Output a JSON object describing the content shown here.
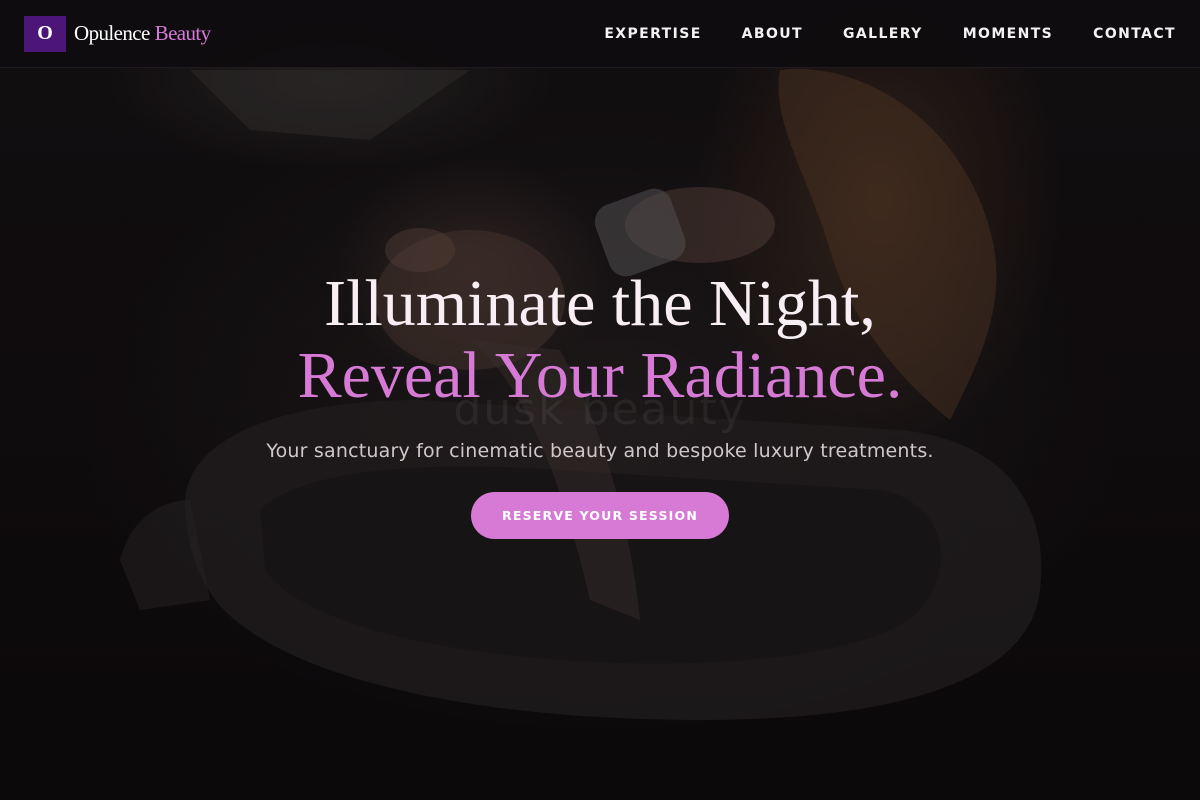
{
  "brand": {
    "initial": "O",
    "name": "Opulence",
    "accent": "Beauty"
  },
  "nav": {
    "items": [
      {
        "label": "EXPERTISE"
      },
      {
        "label": "ABOUT"
      },
      {
        "label": "GALLERY"
      },
      {
        "label": "MOMENTS"
      },
      {
        "label": "CONTACT"
      }
    ]
  },
  "hero": {
    "title_line1": "Illuminate the Night,",
    "title_line2": "Reveal Your Radiance.",
    "subtitle": "Your sanctuary for cinematic beauty and bespoke luxury treatments.",
    "cta_label": "RESERVE YOUR SESSION",
    "watermark": "dusk beauty"
  },
  "colors": {
    "accent": "#d67ad6",
    "brand_mark": "#4b1678",
    "navbar_bg": "#0e0c0e",
    "title_text": "#f9eef3"
  }
}
